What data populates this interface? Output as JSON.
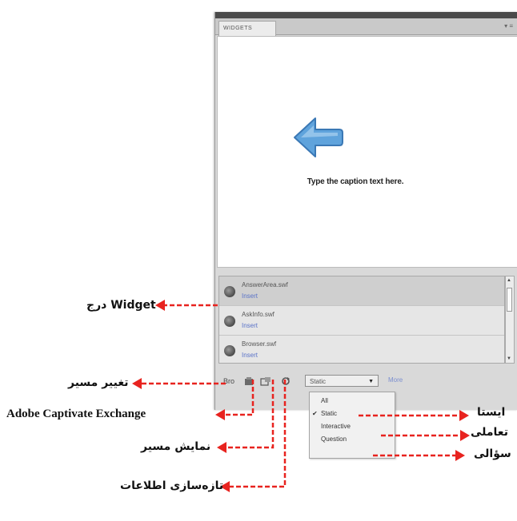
{
  "panel": {
    "tab_label": "WIDGETS",
    "menu_glyph": "▾ ≡",
    "caption": "Type the caption text here.",
    "list": [
      {
        "name": "AnswerArea.swf",
        "link": "Insert"
      },
      {
        "name": "AskInfo.swf",
        "link": "Insert"
      },
      {
        "name": "Browser.swf",
        "link": "Insert"
      }
    ],
    "toolbar": {
      "browse_label": "Bro",
      "filter_value": "Static",
      "more_label": "More"
    },
    "filter_options": [
      "All",
      "Static",
      "Interactive",
      "Question"
    ],
    "filter_checked": "Static"
  },
  "annotations": {
    "insert_widget": "درج Widget",
    "change_path": "تغییر مسیر",
    "exchange": "Adobe Captivate Exchange",
    "show_path": "نمایش مسیر",
    "refresh": "تازه‌سازی اطلاعات",
    "static": "ایستا",
    "interactive": "تعاملی",
    "question": "سؤالی"
  },
  "colors": {
    "annotation_arrow": "#e8231f",
    "arrow_icon": "#5fa3dc",
    "link": "#5a73c8"
  },
  "icons": [
    "gear-icon",
    "exchange-icon",
    "show-path-icon",
    "refresh-icon",
    "left-arrow-icon"
  ]
}
